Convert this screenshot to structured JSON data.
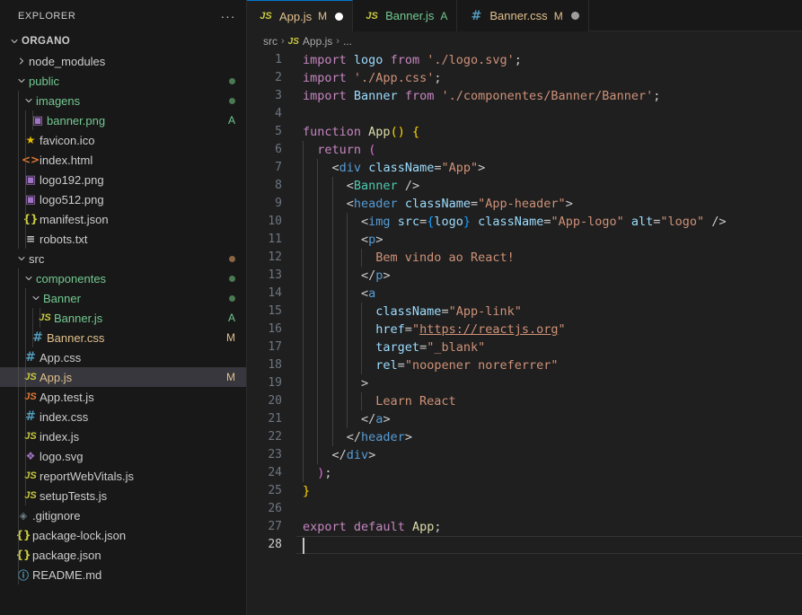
{
  "sidebar": {
    "title": "EXPLORER",
    "more_actions": "···",
    "root": {
      "label": "ORGANO"
    },
    "items": [
      {
        "label": "node_modules",
        "kind": "folder",
        "depth": 1,
        "open": false,
        "icon": "chevron-right-icon",
        "color": "#cccccc",
        "badge": "",
        "dot": ""
      },
      {
        "label": "public",
        "kind": "folder",
        "depth": 1,
        "open": true,
        "icon": "chevron-down-icon",
        "color": "#73c991",
        "badge": "",
        "dot": "#4a7a52"
      },
      {
        "label": "imagens",
        "kind": "folder",
        "depth": 2,
        "open": true,
        "icon": "chevron-down-icon",
        "color": "#73c991",
        "badge": "",
        "dot": "#4a7a52"
      },
      {
        "label": "banner.png",
        "kind": "file",
        "depth": 3,
        "icon": "image-file-icon",
        "glyph": "▣",
        "iconclass": "i-img",
        "color": "#73c991",
        "badge": "A",
        "badgecolor": "#73c991"
      },
      {
        "label": "favicon.ico",
        "kind": "file",
        "depth": 2,
        "icon": "star-file-icon",
        "glyph": "★",
        "iconclass": "i-star",
        "color": "#cccccc",
        "badge": ""
      },
      {
        "label": "index.html",
        "kind": "file",
        "depth": 2,
        "icon": "html-file-icon",
        "glyph": "<>",
        "iconclass": "i-html",
        "color": "#cccccc",
        "badge": ""
      },
      {
        "label": "logo192.png",
        "kind": "file",
        "depth": 2,
        "icon": "image-file-icon",
        "glyph": "▣",
        "iconclass": "i-img",
        "color": "#cccccc",
        "badge": ""
      },
      {
        "label": "logo512.png",
        "kind": "file",
        "depth": 2,
        "icon": "image-file-icon",
        "glyph": "▣",
        "iconclass": "i-img",
        "color": "#cccccc",
        "badge": ""
      },
      {
        "label": "manifest.json",
        "kind": "file",
        "depth": 2,
        "icon": "json-file-icon",
        "glyph": "{}",
        "iconclass": "i-json",
        "color": "#cccccc",
        "badge": ""
      },
      {
        "label": "robots.txt",
        "kind": "file",
        "depth": 2,
        "icon": "text-file-icon",
        "glyph": "≡",
        "iconclass": "i-txt",
        "color": "#cccccc",
        "badge": ""
      },
      {
        "label": "src",
        "kind": "folder",
        "depth": 1,
        "open": true,
        "icon": "chevron-down-icon",
        "color": "#cccccc",
        "badge": "",
        "dot": "#8a6642"
      },
      {
        "label": "componentes",
        "kind": "folder",
        "depth": 2,
        "open": true,
        "icon": "chevron-down-icon",
        "color": "#73c991",
        "badge": "",
        "dot": "#4a7a52"
      },
      {
        "label": "Banner",
        "kind": "folder",
        "depth": 3,
        "open": true,
        "icon": "chevron-down-icon",
        "color": "#73c991",
        "badge": "",
        "dot": "#4a7a52"
      },
      {
        "label": "Banner.js",
        "kind": "file",
        "depth": 4,
        "icon": "js-file-icon",
        "glyph": "JS",
        "iconclass": "i-js",
        "color": "#73c991",
        "badge": "A",
        "badgecolor": "#73c991"
      },
      {
        "label": "Banner.css",
        "kind": "file",
        "depth": 3,
        "icon": "css-file-icon",
        "glyph": "#",
        "iconclass": "i-css",
        "color": "#e2c08d",
        "badge": "M",
        "badgecolor": "#e2c08d"
      },
      {
        "label": "App.css",
        "kind": "file",
        "depth": 2,
        "icon": "css-file-icon",
        "glyph": "#",
        "iconclass": "i-css",
        "color": "#cccccc",
        "badge": ""
      },
      {
        "label": "App.js",
        "kind": "file",
        "depth": 2,
        "icon": "js-file-icon",
        "glyph": "JS",
        "iconclass": "i-js",
        "color": "#e2c08d",
        "badge": "M",
        "badgecolor": "#e2c08d",
        "selected": true
      },
      {
        "label": "App.test.js",
        "kind": "file",
        "depth": 2,
        "icon": "js-test-file-icon",
        "glyph": "JS",
        "iconclass": "i-js",
        "iconcolor": "#e37933",
        "color": "#cccccc",
        "badge": ""
      },
      {
        "label": "index.css",
        "kind": "file",
        "depth": 2,
        "icon": "css-file-icon",
        "glyph": "#",
        "iconclass": "i-css",
        "color": "#cccccc",
        "badge": ""
      },
      {
        "label": "index.js",
        "kind": "file",
        "depth": 2,
        "icon": "js-file-icon",
        "glyph": "JS",
        "iconclass": "i-js",
        "color": "#cccccc",
        "badge": ""
      },
      {
        "label": "logo.svg",
        "kind": "file",
        "depth": 2,
        "icon": "svg-file-icon",
        "glyph": "❖",
        "iconclass": "i-svg",
        "color": "#cccccc",
        "badge": ""
      },
      {
        "label": "reportWebVitals.js",
        "kind": "file",
        "depth": 2,
        "icon": "js-file-icon",
        "glyph": "JS",
        "iconclass": "i-js",
        "color": "#cccccc",
        "badge": ""
      },
      {
        "label": "setupTests.js",
        "kind": "file",
        "depth": 2,
        "icon": "js-file-icon",
        "glyph": "JS",
        "iconclass": "i-js",
        "color": "#cccccc",
        "badge": ""
      },
      {
        "label": ".gitignore",
        "kind": "file",
        "depth": 1,
        "icon": "git-file-icon",
        "glyph": "◈",
        "iconclass": "i-git",
        "color": "#cccccc",
        "badge": ""
      },
      {
        "label": "package-lock.json",
        "kind": "file",
        "depth": 1,
        "icon": "json-file-icon",
        "glyph": "{}",
        "iconclass": "i-json",
        "color": "#cccccc",
        "badge": ""
      },
      {
        "label": "package.json",
        "kind": "file",
        "depth": 1,
        "icon": "json-file-icon",
        "glyph": "{}",
        "iconclass": "i-json",
        "color": "#cccccc",
        "badge": ""
      },
      {
        "label": "README.md",
        "kind": "file",
        "depth": 1,
        "icon": "markdown-file-icon",
        "glyph": "ⓘ",
        "iconclass": "i-md",
        "color": "#cccccc",
        "badge": ""
      }
    ]
  },
  "tabs": [
    {
      "label": "App.js",
      "icon": "js-file-icon",
      "glyph": "JS",
      "iconclass": "i-js",
      "status": "M",
      "statuscolor": "#e2c08d",
      "dirty": true,
      "dotcolor": "#ffffff",
      "active": true,
      "labelcolor": "#e2c08d"
    },
    {
      "label": "Banner.js",
      "icon": "js-file-icon",
      "glyph": "JS",
      "iconclass": "i-js",
      "status": "A",
      "statuscolor": "#73c991",
      "dirty": false,
      "active": false,
      "labelcolor": "#73c991"
    },
    {
      "label": "Banner.css",
      "icon": "css-file-icon",
      "glyph": "#",
      "iconclass": "i-css",
      "status": "M",
      "statuscolor": "#e2c08d",
      "dirty": true,
      "dotcolor": "#9d9d9d",
      "active": false,
      "labelcolor": "#e2c08d"
    }
  ],
  "breadcrumb": {
    "folder": "src",
    "sep1": "›",
    "file": "App.js",
    "file_icon_glyph": "JS",
    "sep2": "›",
    "ellipsis": "..."
  },
  "editor": {
    "filename": "App.js",
    "language": "javascript",
    "cursor_line": 28,
    "total_lines": 28,
    "lines": [
      {
        "n": 1,
        "indent": 0,
        "tokens": [
          [
            "t-kw",
            "import"
          ],
          [
            "t-txt",
            " "
          ],
          [
            "t-var",
            "logo"
          ],
          [
            "t-txt",
            " "
          ],
          [
            "t-kw",
            "from"
          ],
          [
            "t-txt",
            " "
          ],
          [
            "t-str",
            "'./logo.svg'"
          ],
          [
            "t-txt",
            ";"
          ]
        ]
      },
      {
        "n": 2,
        "indent": 0,
        "tokens": [
          [
            "t-kw",
            "import"
          ],
          [
            "t-txt",
            " "
          ],
          [
            "t-str",
            "'./App.css'"
          ],
          [
            "t-txt",
            ";"
          ]
        ]
      },
      {
        "n": 3,
        "indent": 0,
        "tokens": [
          [
            "t-kw",
            "import"
          ],
          [
            "t-txt",
            " "
          ],
          [
            "t-var",
            "Banner"
          ],
          [
            "t-txt",
            " "
          ],
          [
            "t-kw",
            "from"
          ],
          [
            "t-txt",
            " "
          ],
          [
            "t-str",
            "'./componentes/Banner/Banner'"
          ],
          [
            "t-txt",
            ";"
          ]
        ]
      },
      {
        "n": 4,
        "indent": 0,
        "tokens": []
      },
      {
        "n": 5,
        "indent": 0,
        "tokens": [
          [
            "t-kw",
            "function"
          ],
          [
            "t-txt",
            " "
          ],
          [
            "t-fn",
            "App"
          ],
          [
            "t-brk1",
            "()"
          ],
          [
            "t-txt",
            " "
          ],
          [
            "t-brk1",
            "{"
          ]
        ]
      },
      {
        "n": 6,
        "indent": 1,
        "tokens": [
          [
            "t-kw",
            "return"
          ],
          [
            "t-txt",
            " "
          ],
          [
            "t-brk2",
            "("
          ]
        ]
      },
      {
        "n": 7,
        "indent": 2,
        "tokens": [
          [
            "t-punc",
            "<"
          ],
          [
            "t-tag",
            "div"
          ],
          [
            "t-txt",
            " "
          ],
          [
            "t-attr",
            "className"
          ],
          [
            "t-punc",
            "="
          ],
          [
            "t-str",
            "\"App\""
          ],
          [
            "t-punc",
            ">"
          ]
        ]
      },
      {
        "n": 8,
        "indent": 3,
        "tokens": [
          [
            "t-punc",
            "<"
          ],
          [
            "t-comp",
            "Banner"
          ],
          [
            "t-txt",
            " "
          ],
          [
            "t-punc",
            "/>"
          ]
        ]
      },
      {
        "n": 9,
        "indent": 3,
        "tokens": [
          [
            "t-punc",
            "<"
          ],
          [
            "t-tag",
            "header"
          ],
          [
            "t-txt",
            " "
          ],
          [
            "t-attr",
            "className"
          ],
          [
            "t-punc",
            "="
          ],
          [
            "t-str",
            "\"App-header\""
          ],
          [
            "t-punc",
            ">"
          ]
        ]
      },
      {
        "n": 10,
        "indent": 4,
        "tokens": [
          [
            "t-punc",
            "<"
          ],
          [
            "t-tag",
            "img"
          ],
          [
            "t-txt",
            " "
          ],
          [
            "t-attr",
            "src"
          ],
          [
            "t-punc",
            "="
          ],
          [
            "t-brk3",
            "{"
          ],
          [
            "t-var",
            "logo"
          ],
          [
            "t-brk3",
            "}"
          ],
          [
            "t-txt",
            " "
          ],
          [
            "t-attr",
            "className"
          ],
          [
            "t-punc",
            "="
          ],
          [
            "t-str",
            "\"App-logo\""
          ],
          [
            "t-txt",
            " "
          ],
          [
            "t-attr",
            "alt"
          ],
          [
            "t-punc",
            "="
          ],
          [
            "t-str",
            "\"logo\""
          ],
          [
            "t-txt",
            " "
          ],
          [
            "t-punc",
            "/>"
          ]
        ]
      },
      {
        "n": 11,
        "indent": 4,
        "tokens": [
          [
            "t-punc",
            "<"
          ],
          [
            "t-tag",
            "p"
          ],
          [
            "t-punc",
            ">"
          ]
        ]
      },
      {
        "n": 12,
        "indent": 5,
        "tokens": [
          [
            "t-str",
            "Bem vindo ao React!"
          ]
        ]
      },
      {
        "n": 13,
        "indent": 4,
        "tokens": [
          [
            "t-punc",
            "</"
          ],
          [
            "t-tag",
            "p"
          ],
          [
            "t-punc",
            ">"
          ]
        ]
      },
      {
        "n": 14,
        "indent": 4,
        "tokens": [
          [
            "t-punc",
            "<"
          ],
          [
            "t-tag",
            "a"
          ]
        ]
      },
      {
        "n": 15,
        "indent": 5,
        "tokens": [
          [
            "t-attr",
            "className"
          ],
          [
            "t-punc",
            "="
          ],
          [
            "t-str",
            "\"App-link\""
          ]
        ]
      },
      {
        "n": 16,
        "indent": 5,
        "tokens": [
          [
            "t-attr",
            "href"
          ],
          [
            "t-punc",
            "="
          ],
          [
            "t-str",
            "\""
          ],
          [
            "t-link",
            "https://reactjs.org"
          ],
          [
            "t-str",
            "\""
          ]
        ]
      },
      {
        "n": 17,
        "indent": 5,
        "tokens": [
          [
            "t-attr",
            "target"
          ],
          [
            "t-punc",
            "="
          ],
          [
            "t-str",
            "\"_blank\""
          ]
        ]
      },
      {
        "n": 18,
        "indent": 5,
        "tokens": [
          [
            "t-attr",
            "rel"
          ],
          [
            "t-punc",
            "="
          ],
          [
            "t-str",
            "\"noopener noreferrer\""
          ]
        ]
      },
      {
        "n": 19,
        "indent": 4,
        "tokens": [
          [
            "t-punc",
            ">"
          ]
        ]
      },
      {
        "n": 20,
        "indent": 5,
        "tokens": [
          [
            "t-str",
            "Learn React"
          ]
        ]
      },
      {
        "n": 21,
        "indent": 4,
        "tokens": [
          [
            "t-punc",
            "</"
          ],
          [
            "t-tag",
            "a"
          ],
          [
            "t-punc",
            ">"
          ]
        ]
      },
      {
        "n": 22,
        "indent": 3,
        "tokens": [
          [
            "t-punc",
            "</"
          ],
          [
            "t-tag",
            "header"
          ],
          [
            "t-punc",
            ">"
          ]
        ]
      },
      {
        "n": 23,
        "indent": 2,
        "tokens": [
          [
            "t-punc",
            "</"
          ],
          [
            "t-tag",
            "div"
          ],
          [
            "t-punc",
            ">"
          ]
        ]
      },
      {
        "n": 24,
        "indent": 1,
        "tokens": [
          [
            "t-brk2",
            ")"
          ],
          [
            "t-txt",
            ";"
          ]
        ]
      },
      {
        "n": 25,
        "indent": 0,
        "tokens": [
          [
            "t-brk1",
            "}"
          ]
        ]
      },
      {
        "n": 26,
        "indent": 0,
        "tokens": []
      },
      {
        "n": 27,
        "indent": 0,
        "tokens": [
          [
            "t-kw",
            "export"
          ],
          [
            "t-txt",
            " "
          ],
          [
            "t-kw",
            "default"
          ],
          [
            "t-txt",
            " "
          ],
          [
            "t-fn",
            "App"
          ],
          [
            "t-txt",
            ";"
          ]
        ]
      },
      {
        "n": 28,
        "indent": 0,
        "tokens": [],
        "active": true,
        "caret": true
      }
    ]
  },
  "colors": {
    "accent": "#0078d4",
    "sidebar_bg": "#181818",
    "editor_bg": "#1f1f1f",
    "selection_bg": "#37373d",
    "added": "#73c991",
    "modified": "#e2c08d"
  }
}
